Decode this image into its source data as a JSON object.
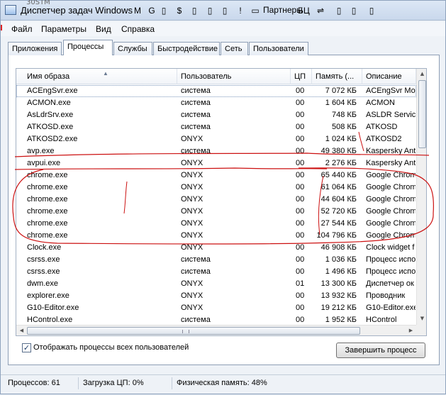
{
  "window": {
    "title": "Диспетчер задач Windows"
  },
  "bookmarks": [
    {
      "icon": "gmail-icon",
      "glyph": "M",
      "label": ""
    },
    {
      "icon": "google-icon",
      "glyph": "G",
      "label": ""
    },
    {
      "icon": "page-icon",
      "glyph": "▯",
      "label": ""
    },
    {
      "icon": "dollar-icon",
      "glyph": "$",
      "label": ""
    },
    {
      "icon": "page-icon",
      "glyph": "▯",
      "label": ""
    },
    {
      "icon": "page-icon",
      "glyph": "▯",
      "label": ""
    },
    {
      "icon": "page-icon",
      "glyph": "▯",
      "label": ""
    },
    {
      "icon": "exclamation-icon",
      "glyph": "!",
      "label": ""
    },
    {
      "icon": "folder-icon",
      "glyph": "▭",
      "label": "Партнеры"
    },
    {
      "icon": "bu-icon",
      "glyph": "БЦ",
      "label": ""
    },
    {
      "icon": "link-icon",
      "glyph": "⇌",
      "label": ""
    },
    {
      "icon": "page-icon",
      "glyph": "▯",
      "label": ""
    },
    {
      "icon": "page-icon",
      "glyph": "▯",
      "label": ""
    },
    {
      "icon": "page-icon",
      "glyph": "▯",
      "label": ""
    }
  ],
  "background": {
    "tab_text": "30STM"
  },
  "menu": [
    "Файл",
    "Параметры",
    "Вид",
    "Справка"
  ],
  "tabs": [
    "Приложения",
    "Процессы",
    "Службы",
    "Быстродействие",
    "Сеть",
    "Пользователи"
  ],
  "active_tab": "Процессы",
  "columns": {
    "name": "Имя образа",
    "user": "Пользователь",
    "cpu": "ЦП",
    "memory": "Память (...",
    "description": "Описание"
  },
  "processes": [
    {
      "name": "ACEngSvr.exe",
      "user": "система",
      "cpu": "00",
      "memory": "7 072 КБ",
      "description": "ACEngSvr Mod"
    },
    {
      "name": "ACMON.exe",
      "user": "система",
      "cpu": "00",
      "memory": "1 604 КБ",
      "description": "ACMON"
    },
    {
      "name": "AsLdrSrv.exe",
      "user": "система",
      "cpu": "00",
      "memory": "748 КБ",
      "description": "ASLDR Service"
    },
    {
      "name": "ATKOSD.exe",
      "user": "система",
      "cpu": "00",
      "memory": "508 КБ",
      "description": "ATKOSD"
    },
    {
      "name": "ATKOSD2.exe",
      "user": "ONYX",
      "cpu": "00",
      "memory": "1 024 КБ",
      "description": "ATKOSD2"
    },
    {
      "name": "avp.exe",
      "user": "система",
      "cpu": "00",
      "memory": "49 380 КБ",
      "description": "Kaspersky Anti"
    },
    {
      "name": "avpui.exe",
      "user": "ONYX",
      "cpu": "00",
      "memory": "2 276 КБ",
      "description": "Kaspersky Anti"
    },
    {
      "name": "chrome.exe",
      "user": "ONYX",
      "cpu": "00",
      "memory": "65 440 КБ",
      "description": "Google Chrome"
    },
    {
      "name": "chrome.exe",
      "user": "ONYX",
      "cpu": "00",
      "memory": "61 064 КБ",
      "description": "Google Chrome"
    },
    {
      "name": "chrome.exe",
      "user": "ONYX",
      "cpu": "00",
      "memory": "44 604 КБ",
      "description": "Google Chrome"
    },
    {
      "name": "chrome.exe",
      "user": "ONYX",
      "cpu": "00",
      "memory": "52 720 КБ",
      "description": "Google Chrome"
    },
    {
      "name": "chrome.exe",
      "user": "ONYX",
      "cpu": "00",
      "memory": "27 544 КБ",
      "description": "Google Chrome"
    },
    {
      "name": "chrome.exe",
      "user": "ONYX",
      "cpu": "00",
      "memory": "104 796 КБ",
      "description": "Google Chrome"
    },
    {
      "name": "Clock.exe",
      "user": "ONYX",
      "cpu": "00",
      "memory": "46 908 КБ",
      "description": "Clock widget f"
    },
    {
      "name": "csrss.exe",
      "user": "система",
      "cpu": "00",
      "memory": "1 036 КБ",
      "description": "Процесс испо"
    },
    {
      "name": "csrss.exe",
      "user": "система",
      "cpu": "00",
      "memory": "1 496 КБ",
      "description": "Процесс испо"
    },
    {
      "name": "dwm.exe",
      "user": "ONYX",
      "cpu": "01",
      "memory": "13 300 КБ",
      "description": "Диспетчер ок"
    },
    {
      "name": "explorer.exe",
      "user": "ONYX",
      "cpu": "00",
      "memory": "13 932 КБ",
      "description": "Проводник"
    },
    {
      "name": "G10-Editor.exe",
      "user": "ONYX",
      "cpu": "00",
      "memory": "19 212 КБ",
      "description": "G10-Editor.exe"
    },
    {
      "name": "HControl.exe",
      "user": "система",
      "cpu": "00",
      "memory": "1 952 КБ",
      "description": "HControl"
    }
  ],
  "show_all_users": {
    "label": "Отображать процессы всех пользователей",
    "checked": true
  },
  "end_process_button": "Завершить процесс",
  "status": {
    "processes": "Процессов: 61",
    "cpu": "Загрузка ЦП: 0%",
    "memory": "Физическая память: 48%"
  },
  "colors": {
    "annotation": "#cc1111",
    "accent": "#213f6a"
  }
}
